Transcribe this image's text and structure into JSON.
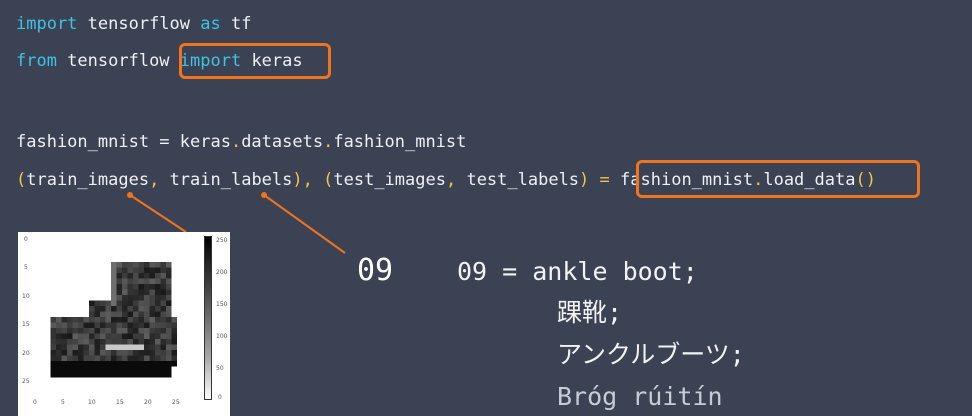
{
  "code": {
    "line1": {
      "kw1": "import",
      "t1": " tensorflow ",
      "kw2": "as",
      "t2": " tf"
    },
    "line2": {
      "kw1": "from",
      "t1": " tensorflow ",
      "kw2": "import",
      "t2": " keras"
    },
    "line3": {
      "t1": "fashion_mnist = keras",
      "p1": ".",
      "t2": "datasets",
      "p2": ".",
      "t3": "fashion_mnist"
    },
    "line4": {
      "p1": "(",
      "t1": "train_images",
      "p2": ",",
      "t2": " train_labels",
      "p3": "),",
      "sp1": " ",
      "p4": "(",
      "t3": "test_images",
      "p5": ",",
      "t4": " test_labels",
      "p6": ")",
      "t5": " ",
      "p7": "=",
      "t6": " fashion_mnist",
      "p8": ".",
      "t7": "load_data",
      "p9": "()"
    }
  },
  "plot": {
    "y_ticks": [
      "0",
      "5",
      "10",
      "15",
      "20",
      "25"
    ],
    "x_ticks": [
      "0",
      "5",
      "10",
      "15",
      "20",
      "25"
    ],
    "cbar_ticks": [
      "250",
      "200",
      "150",
      "100",
      "50",
      "0"
    ]
  },
  "label": {
    "big_number": "09",
    "line1": "09 = ankle boot;",
    "line2": "踝靴;",
    "line3": "アンクルブーツ;",
    "line4": "Bróg rúitín"
  },
  "colors": {
    "background": "#3b4253",
    "highlight": "#f0731e",
    "keyword": "#3ec2e6",
    "punctuation": "#f6c34a"
  }
}
